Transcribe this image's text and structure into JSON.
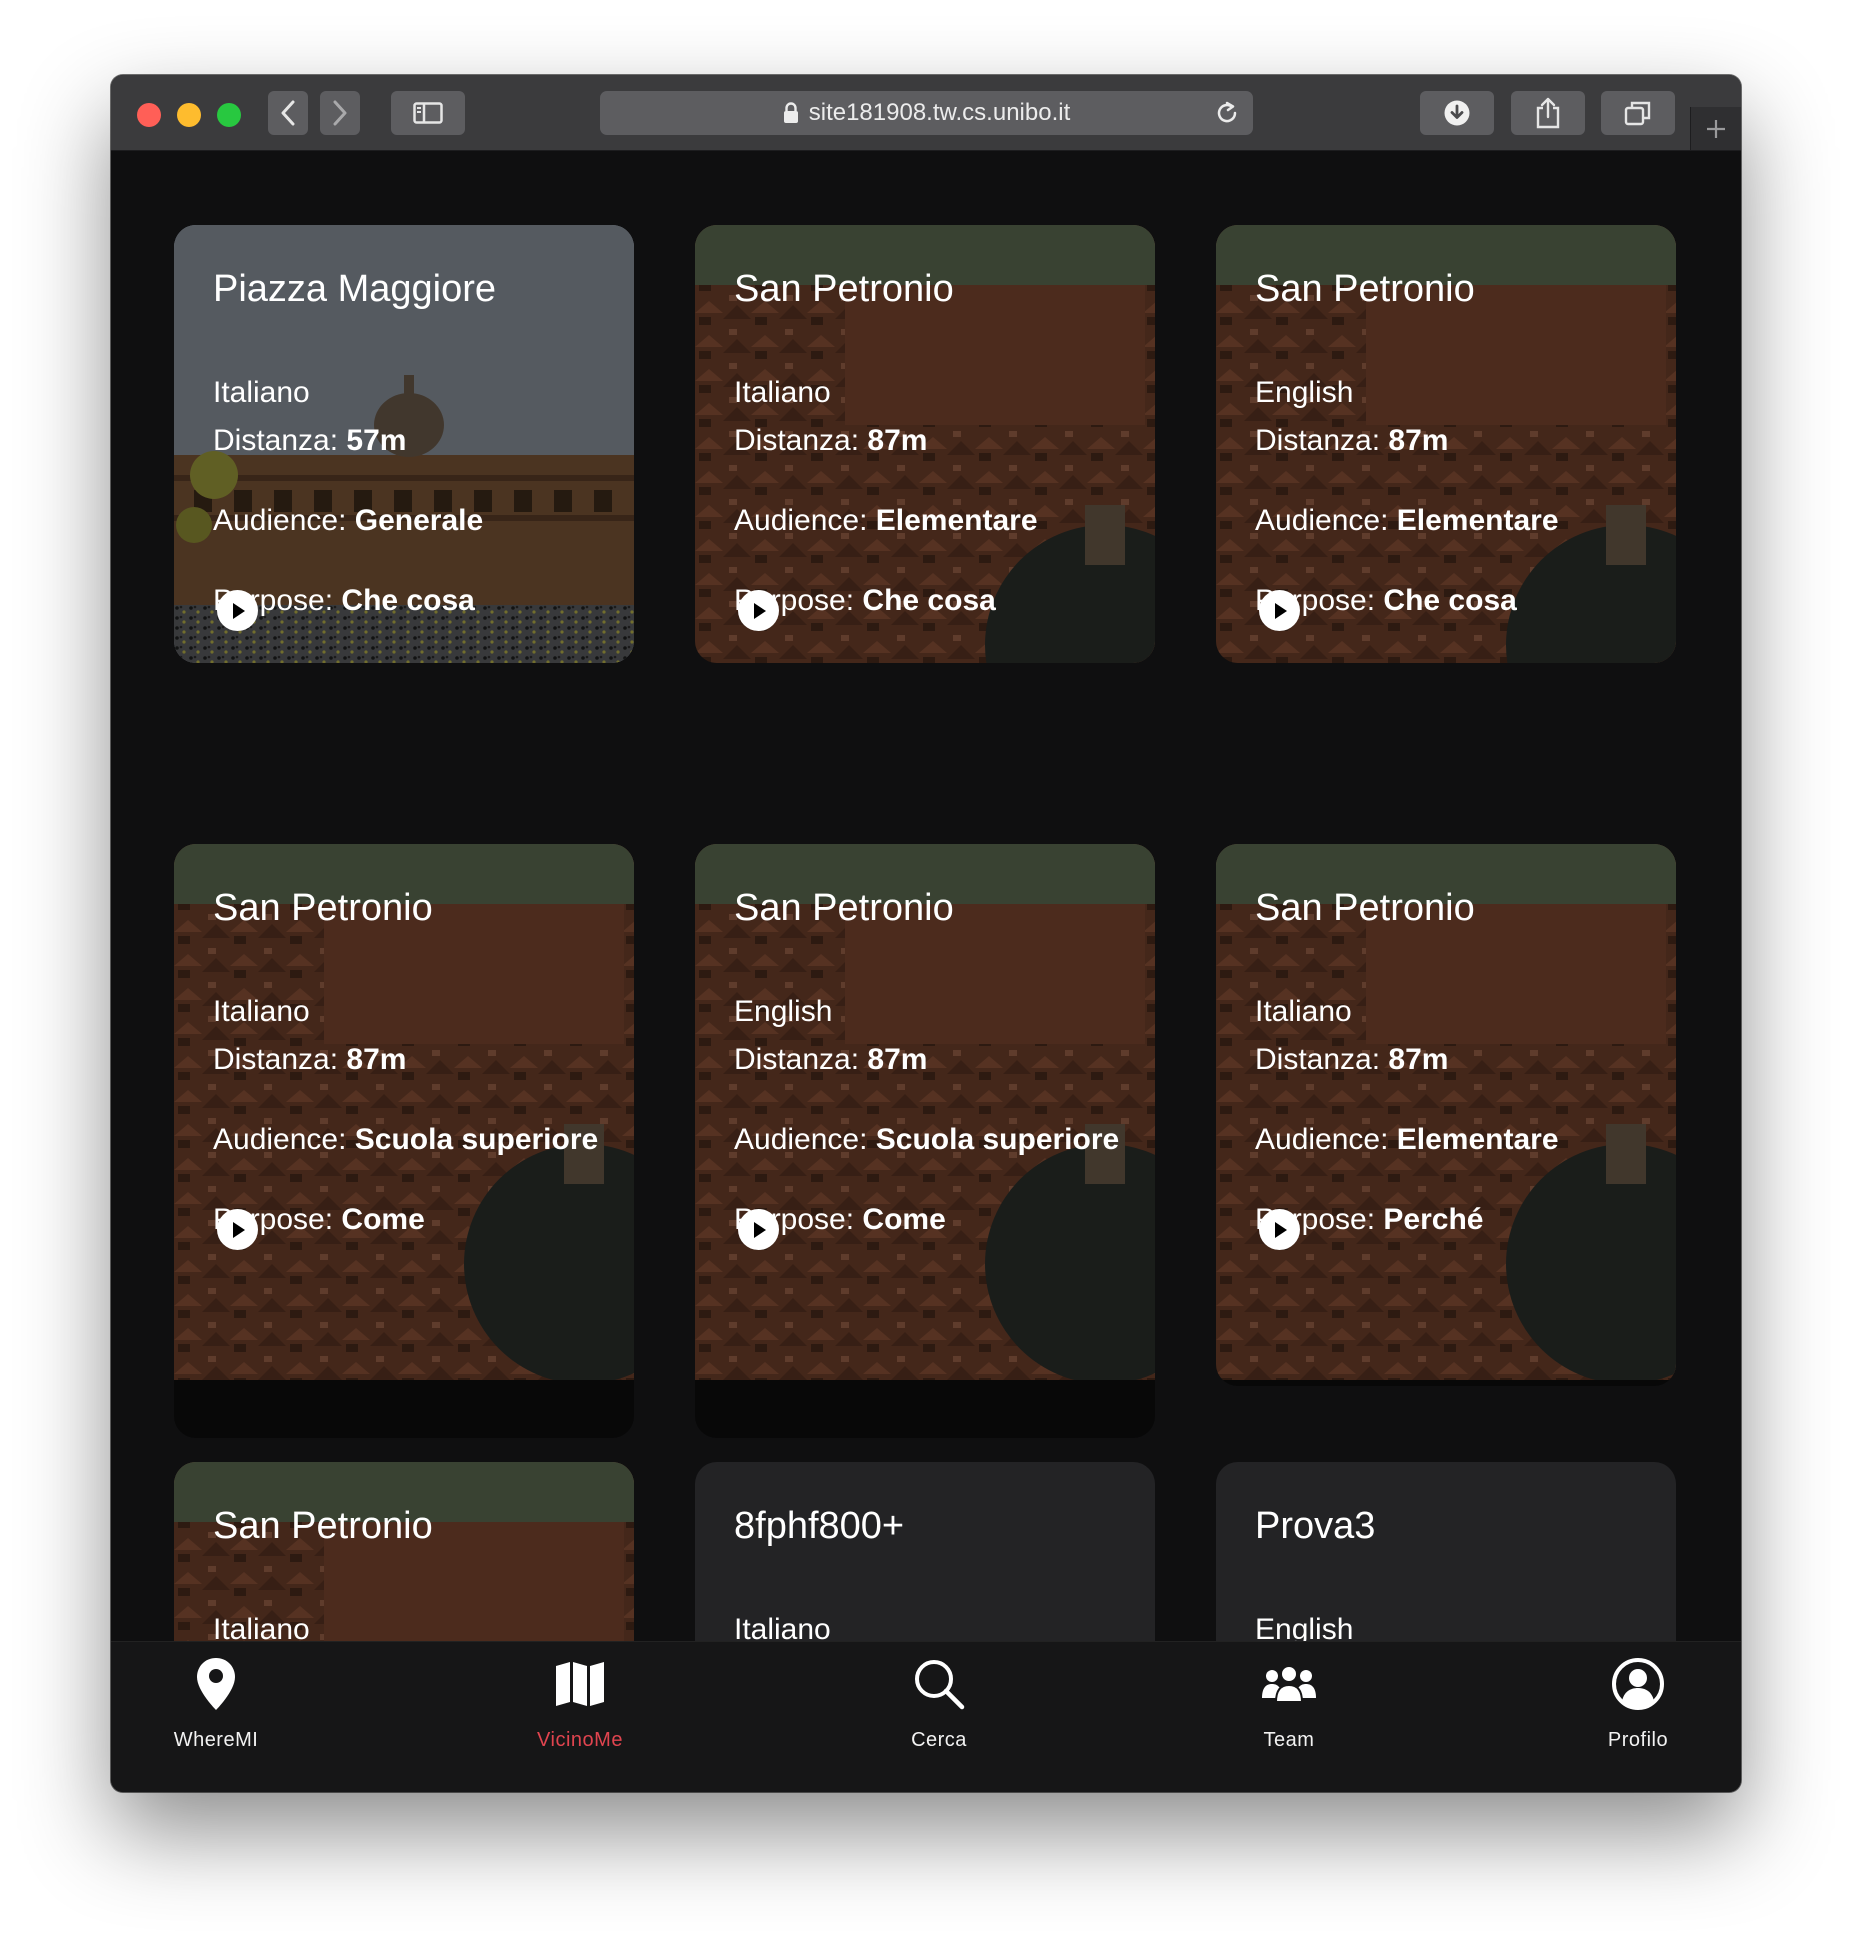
{
  "browser": {
    "url": "site181908.tw.cs.unibo.it"
  },
  "cards": [
    {
      "title": "Piazza Maggiore",
      "language": "Italiano",
      "distance_label": "Distanza:",
      "distance": "57m",
      "audience_label": "Audience:",
      "audience": "Generale",
      "purpose_label": "Purpose:",
      "purpose": "Che cosa",
      "image": "piazza"
    },
    {
      "title": "San Petronio",
      "language": "Italiano",
      "distance_label": "Distanza:",
      "distance": "87m",
      "audience_label": "Audience:",
      "audience": "Elementare",
      "purpose_label": "Purpose:",
      "purpose": "Che cosa",
      "image": "city"
    },
    {
      "title": "San Petronio",
      "language": "English",
      "distance_label": "Distanza:",
      "distance": "87m",
      "audience_label": "Audience:",
      "audience": "Elementare",
      "purpose_label": "Purpose:",
      "purpose": "Che cosa",
      "image": "city"
    },
    {
      "title": "San Petronio",
      "language": "Italiano",
      "distance_label": "Distanza:",
      "distance": "87m",
      "audience_label": "Audience:",
      "audience": "Scuola superiore",
      "purpose_label": "Purpose:",
      "purpose": "Come",
      "image": "city"
    },
    {
      "title": "San Petronio",
      "language": "English",
      "distance_label": "Distanza:",
      "distance": "87m",
      "audience_label": "Audience:",
      "audience": "Scuola superiore",
      "purpose_label": "Purpose:",
      "purpose": "Come",
      "image": "city"
    },
    {
      "title": "San Petronio",
      "language": "Italiano",
      "distance_label": "Distanza:",
      "distance": "87m",
      "audience_label": "Audience:",
      "audience": "Elementare",
      "purpose_label": "Purpose:",
      "purpose": "Perché",
      "image": "city"
    },
    {
      "title": "San Petronio",
      "language": "Italiano",
      "image": "city"
    },
    {
      "title": "8fphf800+",
      "language": "Italiano"
    },
    {
      "title": "Prova3",
      "language": "English"
    }
  ],
  "tabbar": {
    "items": [
      {
        "label": "WhereMI",
        "icon": "map-pin-icon",
        "active": false
      },
      {
        "label": "VicinoMe",
        "icon": "map-icon",
        "active": true
      },
      {
        "label": "Cerca",
        "icon": "search-icon",
        "active": false
      },
      {
        "label": "Team",
        "icon": "team-icon",
        "active": false
      },
      {
        "label": "Profilo",
        "icon": "profile-icon",
        "active": false
      }
    ],
    "active_color": "#e0444f"
  }
}
